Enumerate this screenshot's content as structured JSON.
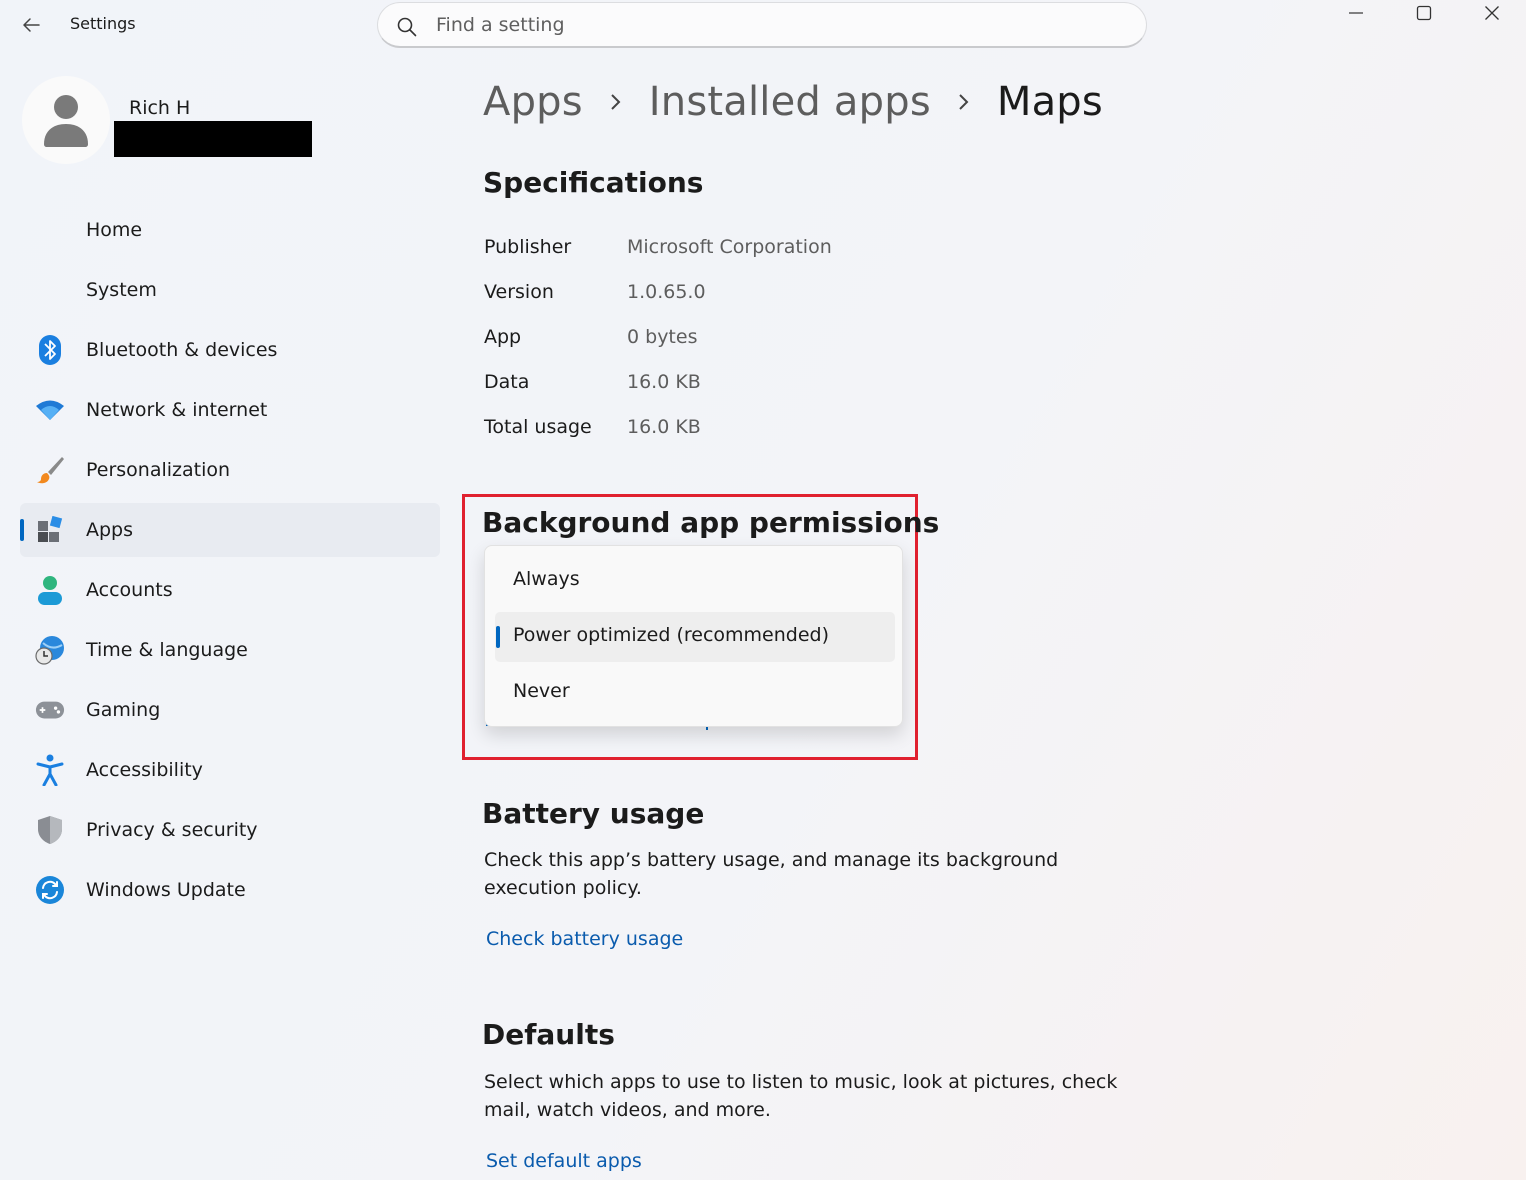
{
  "window": {
    "title": "Settings",
    "controls": {
      "minimize": "minimize",
      "maximize": "maximize",
      "close": "close"
    }
  },
  "search": {
    "placeholder": "Find a setting",
    "value": ""
  },
  "profile": {
    "name": "Rich H"
  },
  "sidebar": {
    "items": [
      {
        "label": "Home",
        "icon": "home-icon"
      },
      {
        "label": "System",
        "icon": "system-icon"
      },
      {
        "label": "Bluetooth & devices",
        "icon": "bluetooth-icon"
      },
      {
        "label": "Network & internet",
        "icon": "wifi-icon"
      },
      {
        "label": "Personalization",
        "icon": "brush-icon"
      },
      {
        "label": "Apps",
        "icon": "apps-icon",
        "active": true
      },
      {
        "label": "Accounts",
        "icon": "person-icon"
      },
      {
        "label": "Time & language",
        "icon": "globe-clock-icon"
      },
      {
        "label": "Gaming",
        "icon": "gamepad-icon"
      },
      {
        "label": "Accessibility",
        "icon": "accessibility-icon"
      },
      {
        "label": "Privacy & security",
        "icon": "shield-icon"
      },
      {
        "label": "Windows Update",
        "icon": "update-icon"
      }
    ]
  },
  "breadcrumb": {
    "items": [
      "Apps",
      "Installed apps",
      "Maps"
    ]
  },
  "specifications": {
    "title": "Specifications",
    "rows": [
      {
        "label": "Publisher",
        "value": "Microsoft Corporation"
      },
      {
        "label": "Version",
        "value": "1.0.65.0"
      },
      {
        "label": "App",
        "value": "0 bytes"
      },
      {
        "label": "Data",
        "value": "16.0 KB"
      },
      {
        "label": "Total usage",
        "value": "16.0 KB"
      }
    ]
  },
  "background_permissions": {
    "title": "Background app permissions",
    "options": [
      "Always",
      "Power optimized (recommended)",
      "Never"
    ],
    "selected": "Power optimized (recommended)"
  },
  "battery": {
    "title": "Battery usage",
    "description": "Check this app’s battery usage, and manage its background execution policy.",
    "link": "Check battery usage"
  },
  "defaults": {
    "title": "Defaults",
    "description": "Select which apps to use to listen to music, look at pictures, check mail, watch videos, and more.",
    "link": "Set default apps"
  },
  "colors": {
    "accent": "#0067c0",
    "link": "#0a5bad",
    "highlight": "#e0202f"
  }
}
